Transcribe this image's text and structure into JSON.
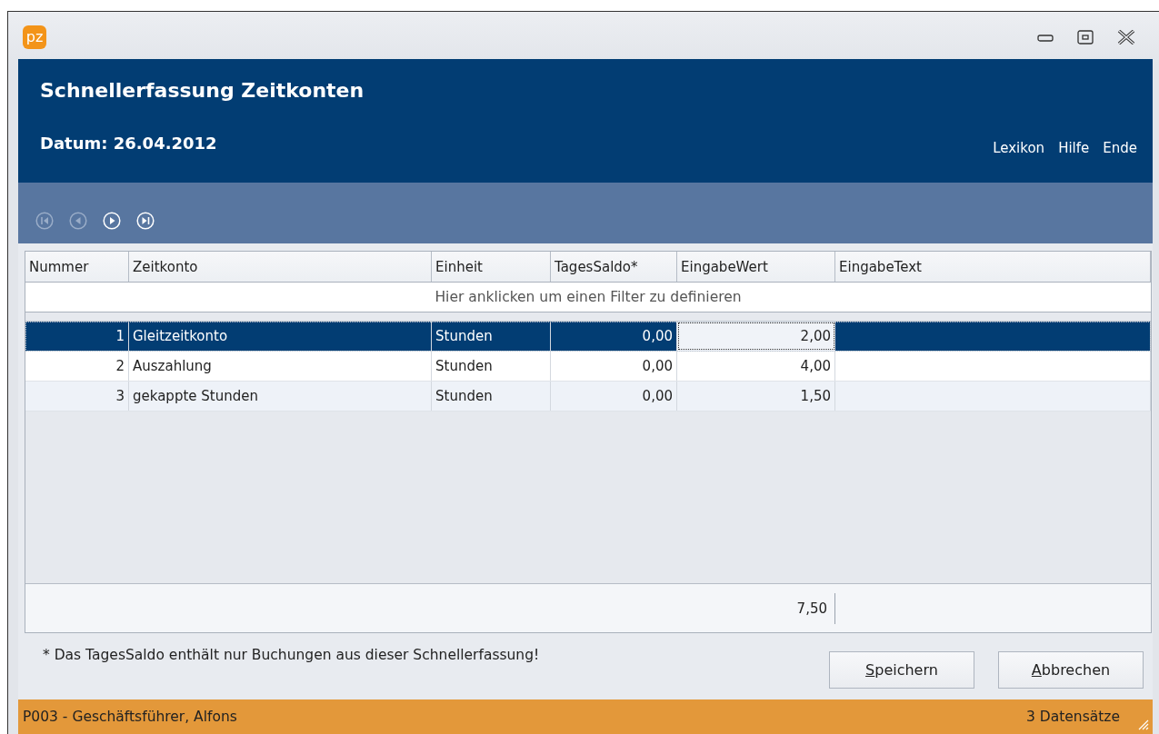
{
  "window": {
    "logo": "pz",
    "title": "Schnellerfassung Zeitkonten",
    "date": "Datum: 26.04.2012"
  },
  "header_links": [
    "Lexikon",
    "Hilfe",
    "Ende"
  ],
  "nav_buttons": [
    {
      "kind": "first",
      "disabled": true
    },
    {
      "kind": "prev",
      "disabled": true
    },
    {
      "kind": "next",
      "disabled": false
    },
    {
      "kind": "last",
      "disabled": false
    }
  ],
  "table": {
    "columns": [
      {
        "label": "Nummer",
        "kind": "number"
      },
      {
        "label": "Zeitkonto",
        "kind": "text"
      },
      {
        "label": "Einheit",
        "kind": "text"
      },
      {
        "label": "TagesSaldo*",
        "kind": "number"
      },
      {
        "label": "EingabeWert",
        "kind": "number",
        "total": "7,50"
      },
      {
        "label": "EingabeText",
        "kind": "text"
      }
    ],
    "filter_hint": "Hier anklicken um einen Filter zu definieren",
    "rows": [
      {
        "selected": true,
        "cells": [
          {
            "text": "1",
            "focused": false
          },
          {
            "text": "Gleitzeitkonto",
            "focused": false
          },
          {
            "text": "Stunden",
            "focused": false
          },
          {
            "text": "0,00",
            "focused": false
          },
          {
            "text": "2,00",
            "focused": true
          }
        ]
      },
      {
        "selected": false,
        "cells": [
          {
            "text": "2",
            "focused": false
          },
          {
            "text": "Auszahlung",
            "focused": false
          },
          {
            "text": "Stunden",
            "focused": false
          },
          {
            "text": "0,00",
            "focused": false
          },
          {
            "text": "4,00",
            "focused": false
          }
        ]
      },
      {
        "selected": false,
        "cells": [
          {
            "text": "3",
            "focused": false
          },
          {
            "text": "gekappte Stunden",
            "focused": false
          },
          {
            "text": "Stunden",
            "focused": false
          },
          {
            "text": "0,00",
            "focused": false
          },
          {
            "text": "1,50",
            "focused": false
          }
        ]
      }
    ]
  },
  "footnote": "* Das TagesSaldo enthält nur Buchungen aus dieser Schnellerfassung!",
  "buttons": [
    "Speichern",
    "Abbrechen"
  ],
  "status_bar": {
    "left": "P003 - Geschäftsführer, Alfons",
    "right": "3 Datensätze"
  }
}
